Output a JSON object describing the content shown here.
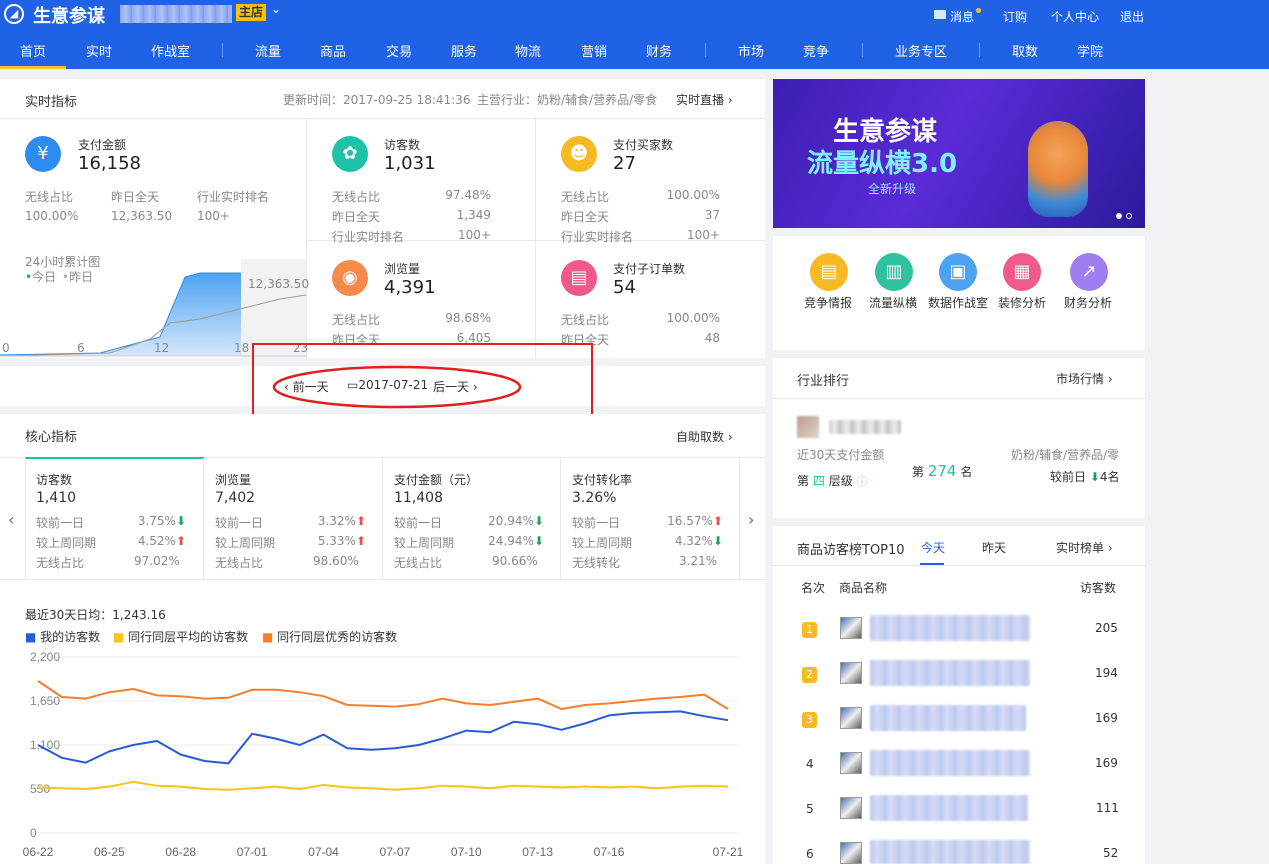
{
  "header": {
    "title": "生意参谋",
    "shop_badge": "主店",
    "messages": "消息",
    "subscribe": "订购",
    "personal": "个人中心",
    "logout": "退出"
  },
  "nav": [
    "首页",
    "实时",
    "作战室",
    "流量",
    "商品",
    "交易",
    "服务",
    "物流",
    "营销",
    "财务",
    "市场",
    "竞争",
    "业务专区",
    "取数",
    "学院"
  ],
  "realtime": {
    "title": "实时指标",
    "updated": "更新时间：2017-09-25 18:41:36",
    "industry": "主营行业：奶粉/辅食/营养品/零食",
    "live": "实时直播",
    "pay": {
      "label": "支付金额",
      "value": "16,158",
      "wl_label": "无线占比",
      "wl": "100.00%",
      "yest_label": "昨日全天",
      "yest": "12,363.50",
      "rank_label": "行业实时排名",
      "rank": "100+"
    },
    "visitors": {
      "label": "访客数",
      "value": "1,031",
      "r1l": "无线占比",
      "r1": "97.48%",
      "r2l": "昨日全天",
      "r2": "1,349",
      "r3l": "行业实时排名",
      "r3": "100+"
    },
    "buyers": {
      "label": "支付买家数",
      "value": "27",
      "r1l": "无线占比",
      "r1": "100.00%",
      "r2l": "昨日全天",
      "r2": "37",
      "r3l": "行业实时排名",
      "r3": "100+"
    },
    "views": {
      "label": "浏览量",
      "value": "4,391",
      "r1l": "无线占比",
      "r1": "98.68%",
      "r2l": "昨日全天",
      "r2": "6,405"
    },
    "suborders": {
      "label": "支付子订单数",
      "value": "54",
      "r1l": "无线占比",
      "r1": "100.00%",
      "r2l": "昨日全天",
      "r2": "48"
    },
    "mini_chart": {
      "title": "24小时累计图",
      "today": "今日",
      "yesterday": "昨日",
      "peak_label": "12,363.50",
      "xticks": [
        "0",
        "6",
        "12",
        "18",
        "23"
      ]
    }
  },
  "datebar": {
    "prev": "前一天",
    "date": "2017-07-21",
    "next": "后一天"
  },
  "core": {
    "title": "核心指标",
    "self_fetch": "自助取数",
    "cards": [
      {
        "label": "访客数",
        "value": "1,410",
        "l1": "较前一日",
        "v1": "3.75%",
        "d1": "down",
        "l2": "较上周同期",
        "v2": "4.52%",
        "d2": "up",
        "l3": "无线占比",
        "v3": "97.02%"
      },
      {
        "label": "浏览量",
        "value": "7,402",
        "l1": "较前一日",
        "v1": "3.32%",
        "d1": "up",
        "l2": "较上周同期",
        "v2": "5.33%",
        "d2": "up",
        "l3": "无线占比",
        "v3": "98.60%"
      },
      {
        "label": "支付金额（元）",
        "value": "11,408",
        "l1": "较前一日",
        "v1": "20.94%",
        "d1": "down",
        "l2": "较上周同期",
        "v2": "24.94%",
        "d2": "down",
        "l3": "无线占比",
        "v3": "90.66%"
      },
      {
        "label": "支付转化率",
        "value": "3.26%",
        "l1": "较前一日",
        "v1": "16.57%",
        "d1": "up",
        "l2": "较上周同期",
        "v2": "4.32%",
        "d2": "down",
        "l3": "无线转化",
        "v3": "3.21%"
      }
    ],
    "avg": "最近30天日均：1,243.16"
  },
  "chart_data": {
    "type": "line",
    "x": [
      "06-22",
      "06-23",
      "06-24",
      "06-25",
      "06-26",
      "06-27",
      "06-28",
      "06-29",
      "06-30",
      "07-01",
      "07-02",
      "07-03",
      "07-04",
      "07-05",
      "07-06",
      "07-07",
      "07-08",
      "07-09",
      "07-10",
      "07-11",
      "07-12",
      "07-13",
      "07-14",
      "07-15",
      "07-16",
      "07-17",
      "07-18",
      "07-19",
      "07-20",
      "07-21"
    ],
    "xticks": [
      "06-22",
      "06-25",
      "06-28",
      "07-01",
      "07-04",
      "07-07",
      "07-10",
      "07-13",
      "07-16",
      "07-21"
    ],
    "yticks": [
      "0",
      "550",
      "1,100",
      "1,650",
      "2,200"
    ],
    "ylim": [
      0,
      2200
    ],
    "series": [
      {
        "name": "我的访客数",
        "color": "#2a5ad7",
        "values": [
          1100,
          940,
          880,
          1020,
          1100,
          1150,
          980,
          900,
          870,
          1240,
          1180,
          1100,
          1230,
          1060,
          1040,
          1060,
          1100,
          1180,
          1280,
          1260,
          1390,
          1360,
          1290,
          1370,
          1470,
          1500,
          1510,
          1520,
          1460,
          1410
        ]
      },
      {
        "name": "同行同层平均的访客数",
        "color": "#f5c518",
        "values": [
          570,
          560,
          550,
          580,
          640,
          590,
          580,
          550,
          540,
          560,
          580,
          550,
          600,
          570,
          560,
          540,
          560,
          590,
          580,
          560,
          590,
          580,
          570,
          580,
          570,
          580,
          560,
          580,
          590,
          580
        ]
      },
      {
        "name": "同行同层优秀的访客数",
        "color": "#f57f2a",
        "values": [
          1900,
          1700,
          1680,
          1760,
          1800,
          1720,
          1710,
          1680,
          1690,
          1790,
          1790,
          1760,
          1710,
          1600,
          1590,
          1580,
          1610,
          1680,
          1620,
          1600,
          1640,
          1680,
          1550,
          1600,
          1620,
          1650,
          1680,
          1700,
          1730,
          1550
        ]
      }
    ]
  },
  "banner": {
    "line1": "生意参谋",
    "line2": "流量纵横3.0",
    "line3": "全新升级"
  },
  "tools": [
    "竞争情报",
    "流量纵横",
    "数据作战室",
    "装修分析",
    "财务分析"
  ],
  "industry_rank": {
    "title": "行业排行",
    "market": "市场行情",
    "pay30": "近30天支付金额",
    "category": "奶粉/辅食/营养品/零",
    "level_pre": "第",
    "level_num": "四",
    "level_suf": "层级",
    "rank_pre": "第",
    "rank_num": "274",
    "rank_suf": "名",
    "compare": "较前日",
    "compare_val": "4名"
  },
  "top10": {
    "title": "商品访客榜TOP10",
    "tab_today": "今天",
    "tab_yest": "昨天",
    "live": "实时榜单",
    "col_rank": "名次",
    "col_name": "商品名称",
    "col_visitors": "访客数",
    "rows": [
      {
        "rank": "1",
        "v": "205"
      },
      {
        "rank": "2",
        "v": "194"
      },
      {
        "rank": "3",
        "v": "169"
      },
      {
        "rank": "4",
        "v": "169"
      },
      {
        "rank": "5",
        "v": "111"
      },
      {
        "rank": "6",
        "v": "52"
      }
    ]
  }
}
